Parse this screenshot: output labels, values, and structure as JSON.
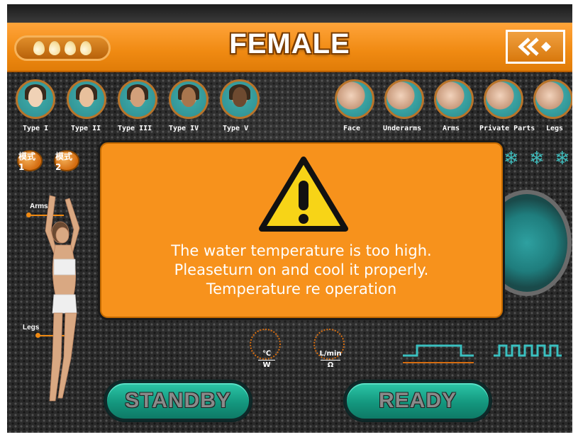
{
  "header": {
    "title": "FEMALE",
    "water_level_drops": 4,
    "back_button_icon": "double-chevron-left-icon"
  },
  "skin_types": [
    {
      "label": "Type I",
      "tone": "#f0d2b6"
    },
    {
      "label": "Type II",
      "tone": "#e8c09c"
    },
    {
      "label": "Type III",
      "tone": "#d2a07a"
    },
    {
      "label": "Type IV",
      "tone": "#a8764e"
    },
    {
      "label": "Type V",
      "tone": "#6e4a30"
    }
  ],
  "body_areas": [
    "Face",
    "Underarms",
    "Arms",
    "Private Parts",
    "Legs"
  ],
  "modes": [
    "模式1",
    "模式2"
  ],
  "cooling_icons": [
    "snowflake-icon",
    "snowflake-icon",
    "snowflake-icon"
  ],
  "body_map_labels": {
    "arms": "Arms",
    "legs": "Legs"
  },
  "gauges": {
    "temperature": {
      "top_unit": "℃",
      "bottom_unit": "W"
    },
    "flow": {
      "top_unit": "L/min",
      "bottom_unit": "Ω"
    }
  },
  "buttons": {
    "standby": "STANDBY",
    "ready": "READY"
  },
  "alert": {
    "icon": "warning-triangle-icon",
    "line1": "The water temperature is too high.",
    "line2": "Pleaseturn on and cool it properly.",
    "line3": "Temperature re operation"
  },
  "colors": {
    "accent_orange": "#f7921c",
    "teal": "#2cb8a0",
    "warning_yellow": "#f7d417"
  }
}
